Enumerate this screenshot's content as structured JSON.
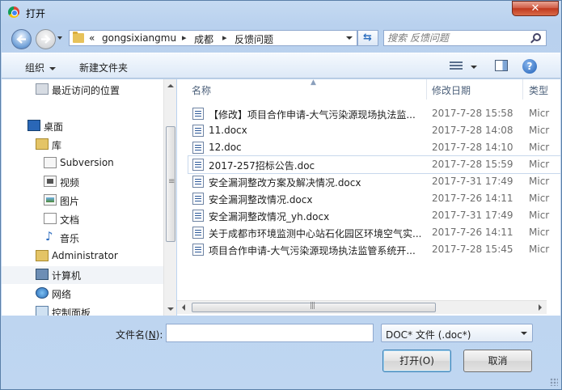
{
  "window": {
    "title": "打开",
    "close_label": "✕"
  },
  "address": {
    "overflow": "«",
    "crumbs": [
      "gongsixiangmu",
      "成都",
      "反馈问题"
    ],
    "search_placeholder": "搜索 反馈问题"
  },
  "toolbar": {
    "organize": "组织",
    "new_folder": "新建文件夹",
    "help": "?"
  },
  "nav_pane": {
    "items": [
      {
        "label": "最近访问的位置",
        "icon": "recent-places-icon"
      },
      {
        "label": "桌面",
        "icon": "desktop-icon"
      },
      {
        "label": "库",
        "icon": "library-icon"
      },
      {
        "label": "Subversion",
        "icon": "subversion-icon"
      },
      {
        "label": "视频",
        "icon": "video-icon"
      },
      {
        "label": "图片",
        "icon": "pictures-icon"
      },
      {
        "label": "文档",
        "icon": "documents-icon"
      },
      {
        "label": "音乐",
        "icon": "music-icon"
      },
      {
        "label": "Administrator",
        "icon": "user-folder-icon"
      },
      {
        "label": "计算机",
        "icon": "computer-icon"
      },
      {
        "label": "网络",
        "icon": "network-icon"
      },
      {
        "label": "控制面板",
        "icon": "control-panel-icon"
      }
    ]
  },
  "file_list": {
    "columns": {
      "name": "名称",
      "modified": "修改日期",
      "type": "类型"
    },
    "rows": [
      {
        "name": "【修改】项目合作申请-大气污染源现场执法监...",
        "modified": "2017-7-28 15:58",
        "type": "Micr"
      },
      {
        "name": "11.docx",
        "modified": "2017-7-28 14:08",
        "type": "Micr"
      },
      {
        "name": "12.doc",
        "modified": "2017-7-28 14:10",
        "type": "Micr"
      },
      {
        "name": "2017-257招标公告.doc",
        "modified": "2017-7-28 15:59",
        "type": "Micr"
      },
      {
        "name": "安全漏洞整改方案及解决情况.docx",
        "modified": "2017-7-31 17:49",
        "type": "Micr"
      },
      {
        "name": "安全漏洞整改情况.docx",
        "modified": "2017-7-26 14:11",
        "type": "Micr"
      },
      {
        "name": "安全漏洞整改情况_yh.docx",
        "modified": "2017-7-31 17:49",
        "type": "Micr"
      },
      {
        "name": "关于成都市环境监测中心站石化园区环境空气实...",
        "modified": "2017-7-26 14:11",
        "type": "Micr"
      },
      {
        "name": "项目合作申请-大气污染源现场执法监管系统开...",
        "modified": "2017-7-28 15:45",
        "type": "Micr"
      }
    ]
  },
  "footer": {
    "filename_label": "文件名(",
    "filename_hotkey": "N",
    "filename_label_end": "):",
    "filename_value": "",
    "filetype_selected": "DOC* 文件 (.doc*)",
    "open_button": "打开(O)",
    "cancel_button": "取消"
  }
}
